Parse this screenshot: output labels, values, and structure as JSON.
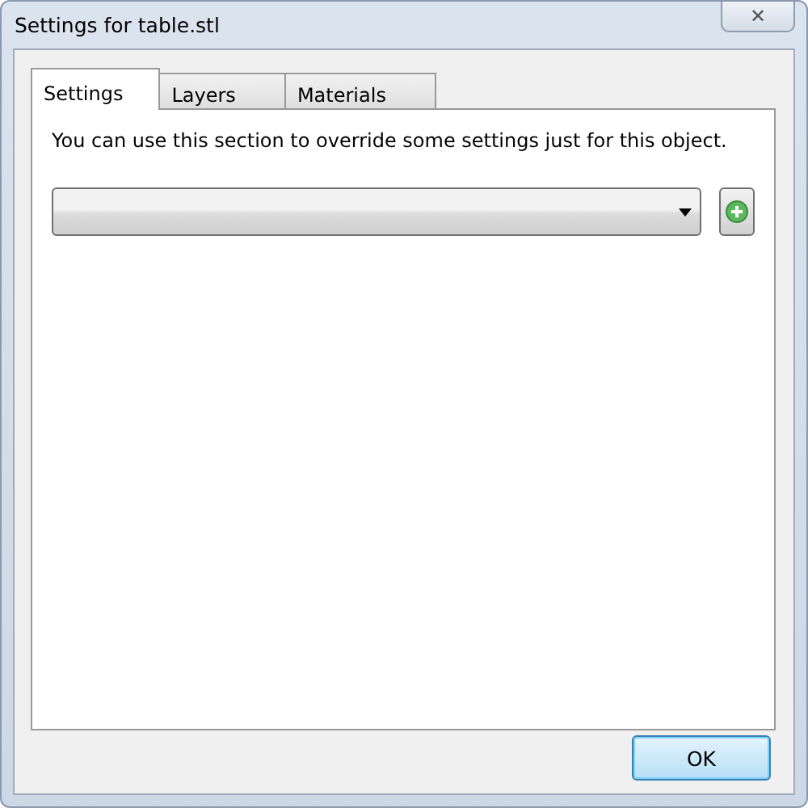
{
  "window": {
    "title": "Settings for table.stl",
    "close": "✕"
  },
  "tabs": [
    {
      "label": "Settings",
      "selected": true
    },
    {
      "label": "Layers",
      "selected": false
    },
    {
      "label": "Materials",
      "selected": false
    }
  ],
  "description": "You can use this section to override some settings just for this object.",
  "buttons": [
    {
      "label": "OK",
      "kind": "default"
    }
  ]
}
